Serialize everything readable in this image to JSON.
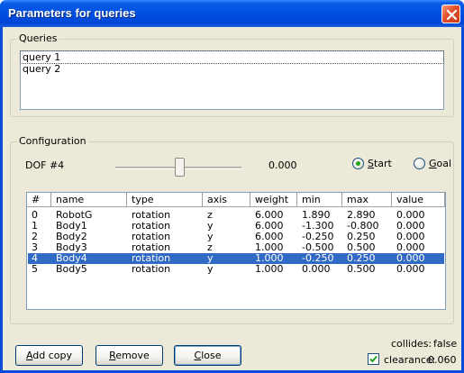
{
  "window": {
    "title": "Parameters for queries"
  },
  "queries": {
    "legend": "Queries",
    "items": [
      "query 1",
      "query 2"
    ]
  },
  "configuration": {
    "legend": "Configuration",
    "dof_label": "DOF #4",
    "dof_value": "0.000",
    "slider_fraction": 0.5,
    "radio_start": "Start",
    "radio_goal": "Goal",
    "selected_radio": "Start",
    "table": {
      "columns": [
        "#",
        "name",
        "type",
        "axis",
        "weight",
        "min",
        "max",
        "value"
      ],
      "rows": [
        [
          "0",
          "RobotG",
          "rotation",
          "z",
          "6.000",
          "1.890",
          "2.890",
          "0.000"
        ],
        [
          "1",
          "Body1",
          "rotation",
          "y",
          "6.000",
          "-1.300",
          "-0.800",
          "0.000"
        ],
        [
          "2",
          "Body2",
          "rotation",
          "y",
          "6.000",
          "-0.250",
          "0.250",
          "0.000"
        ],
        [
          "3",
          "Body3",
          "rotation",
          "z",
          "1.000",
          "-0.500",
          "0.500",
          "0.000"
        ],
        [
          "4",
          "Body4",
          "rotation",
          "y",
          "1.000",
          "-0.250",
          "0.250",
          "0.000"
        ],
        [
          "5",
          "Body5",
          "rotation",
          "y",
          "1.000",
          "0.000",
          "0.500",
          "0.000"
        ]
      ],
      "selected_row": 4
    }
  },
  "buttons": {
    "add_copy": "Add copy",
    "remove": "Remove",
    "close": "Close"
  },
  "status": {
    "collides_label": "collides:",
    "collides_value": "false",
    "clearance_label": "clearance:",
    "clearance_value": "0.060",
    "clearance_checked": true
  },
  "colors": {
    "title_bar": "#0050e0",
    "selection": "#316ac5",
    "dialog_bg": "#ece9d8"
  }
}
